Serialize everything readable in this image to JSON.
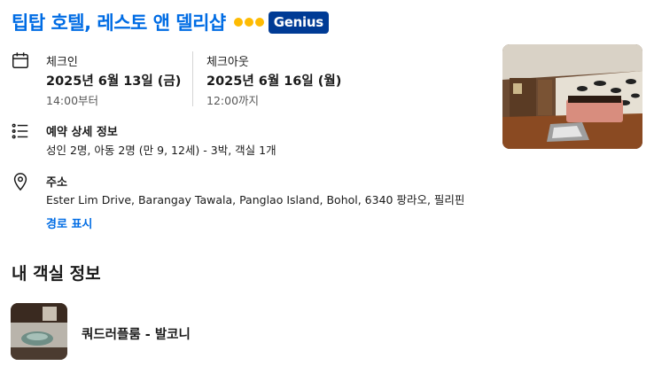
{
  "hotel": {
    "name": "팁탑 호텔, 레스토 앤 델리샵",
    "genius_label": "Genius"
  },
  "checkin": {
    "label": "체크인",
    "date": "2025년 6월 13일 (금)",
    "time": "14:00부터"
  },
  "checkout": {
    "label": "체크아웃",
    "date": "2025년 6월 16일 (월)",
    "time": "12:00까지"
  },
  "booking_details": {
    "heading": "예약 상세 정보",
    "summary": "성인 2명, 아동 2명 (만 9, 12세) - 3박, 객실 1개"
  },
  "address": {
    "heading": "주소",
    "value": "Ester Lim Drive, Barangay Tawala, Panglao Island, Bohol, 6340 팡라오, 필리핀",
    "directions_link": "경로 표시"
  },
  "rooms_section": {
    "title": "내 객실 정보",
    "rooms": [
      {
        "name": "쿼드러플룸 - 발코니"
      }
    ]
  },
  "colors": {
    "title_blue": "#006ce4",
    "genius_navy": "#003b95",
    "genius_dots": "#febb02"
  },
  "icons": {
    "calendar": "calendar-icon",
    "list": "list-icon",
    "location": "location-pin-icon"
  }
}
